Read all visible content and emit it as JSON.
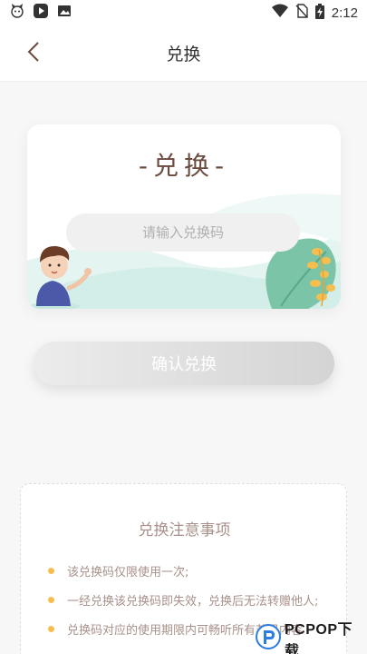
{
  "status_bar": {
    "time": "2:12",
    "left_icons": [
      "cat-notification-icon",
      "play-store-icon",
      "image-icon"
    ],
    "right_icons": [
      "wifi-icon",
      "no-sim-icon",
      "battery-charging-icon"
    ]
  },
  "nav": {
    "title": "兑换",
    "back_icon": "chevron-left-icon"
  },
  "card": {
    "title": "-兑换-",
    "input_placeholder": "请输入兑换码",
    "input_value": ""
  },
  "confirm_button": {
    "label": "确认兑换"
  },
  "notes": {
    "title": "兑换注意事项",
    "items": [
      "该兑换码仅限使用一次;",
      "一经兑换该兑换码即失效，兑换后无法转赠他人;",
      "兑换码对应的使用期限内可畅听所有节目内容"
    ]
  },
  "watermark": {
    "text": "PCPOP下载"
  },
  "colors": {
    "title_brown": "#6b4a3f",
    "note_text": "#a9908a",
    "bullet": "#f5be4f",
    "button_gradient_start": "#ececec",
    "button_gradient_end": "#d4d4d4"
  }
}
